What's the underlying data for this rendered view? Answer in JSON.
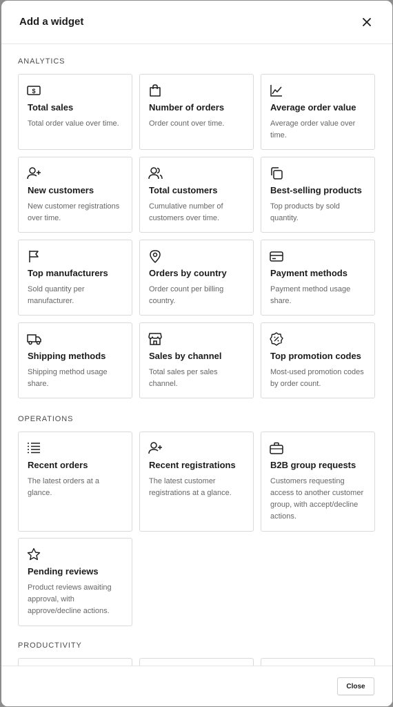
{
  "modal": {
    "title": "Add a widget",
    "footer_close_label": "Close"
  },
  "sections": {
    "analytics": {
      "label": "ANALYTICS",
      "cards": [
        {
          "icon": "dollar-bill-icon",
          "title": "Total sales",
          "description": "Total order value over time."
        },
        {
          "icon": "shopping-bag-icon",
          "title": "Number of orders",
          "description": "Order count over time."
        },
        {
          "icon": "line-chart-icon",
          "title": "Average order value",
          "description": "Average order value over time."
        },
        {
          "icon": "user-plus-icon",
          "title": "New customers",
          "description": "New customer registrations over time."
        },
        {
          "icon": "users-icon",
          "title": "Total customers",
          "description": "Cumulative number of customers over time."
        },
        {
          "icon": "copy-icon",
          "title": "Best-selling products",
          "description": "Top products by sold quantity."
        },
        {
          "icon": "flag-icon",
          "title": "Top manufacturers",
          "description": "Sold quantity per manufacturer."
        },
        {
          "icon": "map-pin-icon",
          "title": "Orders by country",
          "description": "Order count per billing country."
        },
        {
          "icon": "credit-card-icon",
          "title": "Payment methods",
          "description": "Payment method usage share."
        },
        {
          "icon": "truck-icon",
          "title": "Shipping methods",
          "description": "Shipping method usage share."
        },
        {
          "icon": "storefront-icon",
          "title": "Sales by channel",
          "description": "Total sales per sales channel."
        },
        {
          "icon": "discount-badge-icon",
          "title": "Top promotion codes",
          "description": "Most-used promotion codes by order count."
        }
      ]
    },
    "operations": {
      "label": "OPERATIONS",
      "cards": [
        {
          "icon": "list-icon",
          "title": "Recent orders",
          "description": "The latest orders at a glance."
        },
        {
          "icon": "user-plus-icon",
          "title": "Recent registrations",
          "description": "The latest customer registrations at a glance."
        },
        {
          "icon": "briefcase-icon",
          "title": "B2B group requests",
          "description": "Customers requesting access to another customer group, with accept/decline actions."
        },
        {
          "icon": "star-icon",
          "title": "Pending reviews",
          "description": "Product reviews awaiting approval, with approve/decline actions."
        }
      ]
    },
    "productivity": {
      "label": "PRODUCTIVITY"
    }
  }
}
